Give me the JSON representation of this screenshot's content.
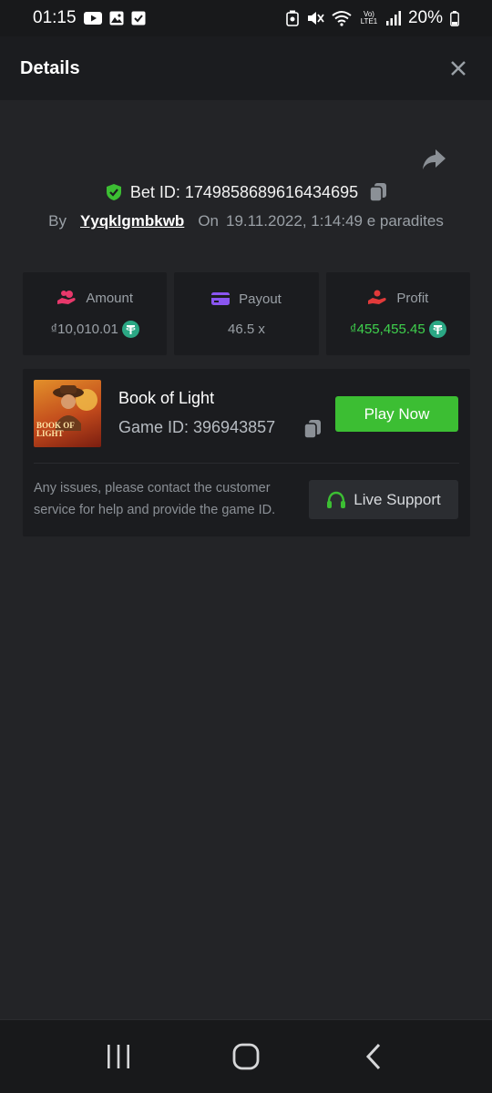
{
  "status_bar": {
    "time": "01:15",
    "battery": "20%",
    "network_label": "Vo) LTE1"
  },
  "header": {
    "title": "Details"
  },
  "bet": {
    "bet_id_label": "Bet ID: 1749858689616434695",
    "by_label": "By",
    "username": "Yyqklgmbkwb",
    "on_label": "On",
    "timestamp": "19.11.2022, 1:14:49 e paradites"
  },
  "stats": {
    "amount": {
      "label": "Amount",
      "value": "₫10,010.01",
      "icon": "coins-hand-icon",
      "icon_color": "#e8386b"
    },
    "payout": {
      "label": "Payout",
      "value": "46.5 x",
      "icon": "card-icon",
      "icon_color": "#8a55f0"
    },
    "profit": {
      "label": "Profit",
      "value": "₫455,455.45",
      "icon": "hand-user-icon",
      "icon_color": "#e23a3a",
      "value_color": "#3fd24d"
    }
  },
  "game": {
    "name": "Book of Light",
    "game_id_label": "Game ID: 396943857",
    "thumbnail_text": "BOOK OF LIGHT",
    "play_button": "Play Now",
    "issue_text": "Any issues, please contact the customer service for help and provide the game ID.",
    "support_button": "Live Support"
  },
  "colors": {
    "background": "#232427",
    "panel": "#1b1c1f",
    "accent_green": "#3cbe33",
    "tether": "#2ba784"
  }
}
